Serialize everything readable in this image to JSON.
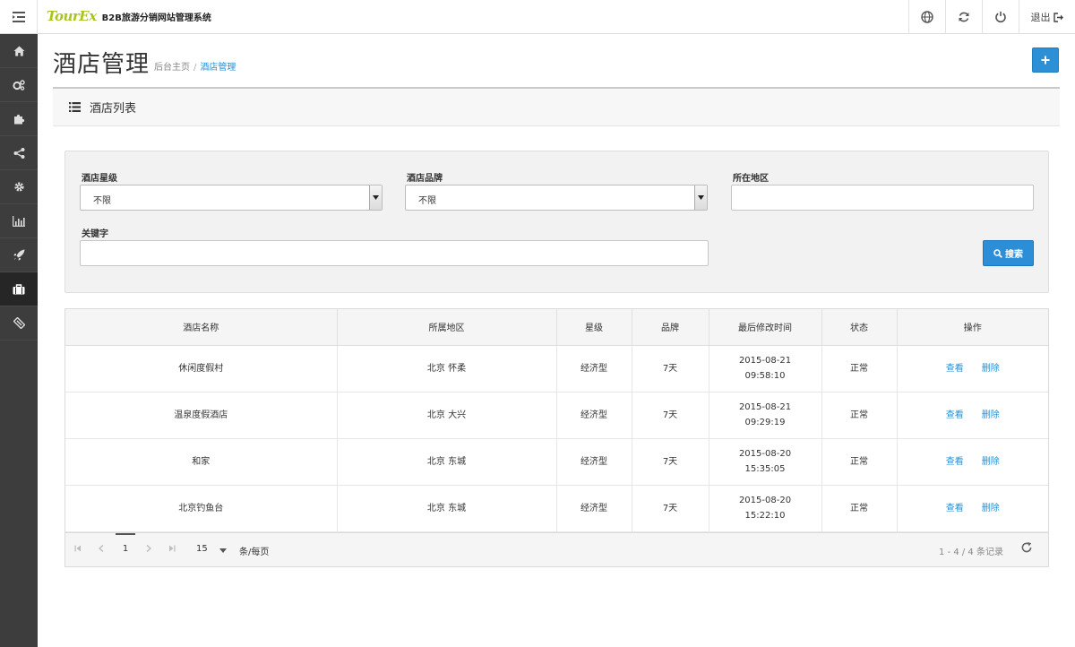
{
  "header": {
    "logo_text": "TourEx",
    "app_title": "B2B旅游分销网站管理系统",
    "logout_label": "退出",
    "actions": [
      "globe-icon",
      "refresh-icon",
      "power-icon"
    ]
  },
  "sidebar": {
    "items": [
      {
        "icon": "home-icon",
        "active": false
      },
      {
        "icon": "cogs-icon",
        "active": false
      },
      {
        "icon": "puzzle-icon",
        "active": false
      },
      {
        "icon": "share-icon",
        "active": false
      },
      {
        "icon": "gear-icon",
        "active": false
      },
      {
        "icon": "bar-chart-icon",
        "active": false
      },
      {
        "icon": "rocket-icon",
        "active": false
      },
      {
        "icon": "briefcase-icon",
        "active": true
      },
      {
        "icon": "ticket-icon",
        "active": false
      }
    ]
  },
  "page": {
    "title": "酒店管理",
    "breadcrumb": {
      "home": "后台主页",
      "separator": "/",
      "current": "酒店管理"
    },
    "panel_title": "酒店列表"
  },
  "filters": {
    "star_label": "酒店星级",
    "star_value": "不限",
    "brand_label": "酒店品牌",
    "brand_value": "不限",
    "region_label": "所在地区",
    "region_value": "",
    "keyword_label": "关键字",
    "keyword_value": "",
    "search_label": "搜索"
  },
  "table": {
    "columns": [
      "酒店名称",
      "所属地区",
      "星级",
      "品牌",
      "最后修改时间",
      "状态",
      "操作"
    ],
    "rows": [
      {
        "name": "休闲度假村",
        "region": "北京 怀柔",
        "star": "经济型",
        "brand": "7天",
        "date": "2015-08-21",
        "time": "09:58:10",
        "status": "正常"
      },
      {
        "name": "温泉度假酒店",
        "region": "北京 大兴",
        "star": "经济型",
        "brand": "7天",
        "date": "2015-08-21",
        "time": "09:29:19",
        "status": "正常"
      },
      {
        "name": "和家",
        "region": "北京 东城",
        "star": "经济型",
        "brand": "7天",
        "date": "2015-08-20",
        "time": "15:35:05",
        "status": "正常"
      },
      {
        "name": "北京钓鱼台",
        "region": "北京 东城",
        "star": "经济型",
        "brand": "7天",
        "date": "2015-08-20",
        "time": "15:22:10",
        "status": "正常"
      }
    ],
    "view_label": "查看",
    "delete_label": "删除"
  },
  "pager": {
    "current_page": "1",
    "page_size": "15",
    "per_page_label": "条/每页",
    "info": "1 - 4 / 4 条记录"
  },
  "colors": {
    "accent": "#2b8ed6",
    "sidebar": "#3d3d3d",
    "link": "#2a8fd0"
  }
}
